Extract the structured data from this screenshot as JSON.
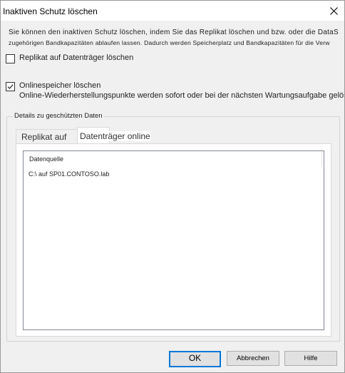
{
  "window": {
    "title": "Inaktiven Schutz löschen"
  },
  "description": {
    "line1": "Sie können den inaktiven Schutz löschen, indem Sie das Replikat löschen und bzw. oder die DataS",
    "line2": "zugehörigen Bandkapazitäten ablaufen lassen. Dadurch werden Speicherplatz und Bandkapazitäten für die Verw"
  },
  "options": {
    "delete_replica": {
      "label": "Replikat auf Datenträger löschen",
      "checked": false
    },
    "delete_online": {
      "label": "Onlinespeicher löschen",
      "sublabel": "Online-Wiederherstellungspunkte werden sofort oder bei der nächsten Wartungsaufgabe gelös",
      "checked": true
    }
  },
  "details": {
    "group_label": "Details zu geschützten Daten",
    "tabs": [
      {
        "label": "Replikat auf Datenträger online"
      }
    ],
    "list": {
      "column_header": "Datenquelle",
      "rows": [
        "C:\\ auf SP01.CONTOSO.lab"
      ]
    }
  },
  "buttons": {
    "ok": "OK",
    "cancel": "Abbrechen",
    "help": "Hilfe"
  },
  "colors": {
    "accent": "#0078d7",
    "dialog_bg": "#f0f0f0"
  },
  "icons": {
    "close": "close-icon",
    "checkmark": "checkmark-icon"
  }
}
